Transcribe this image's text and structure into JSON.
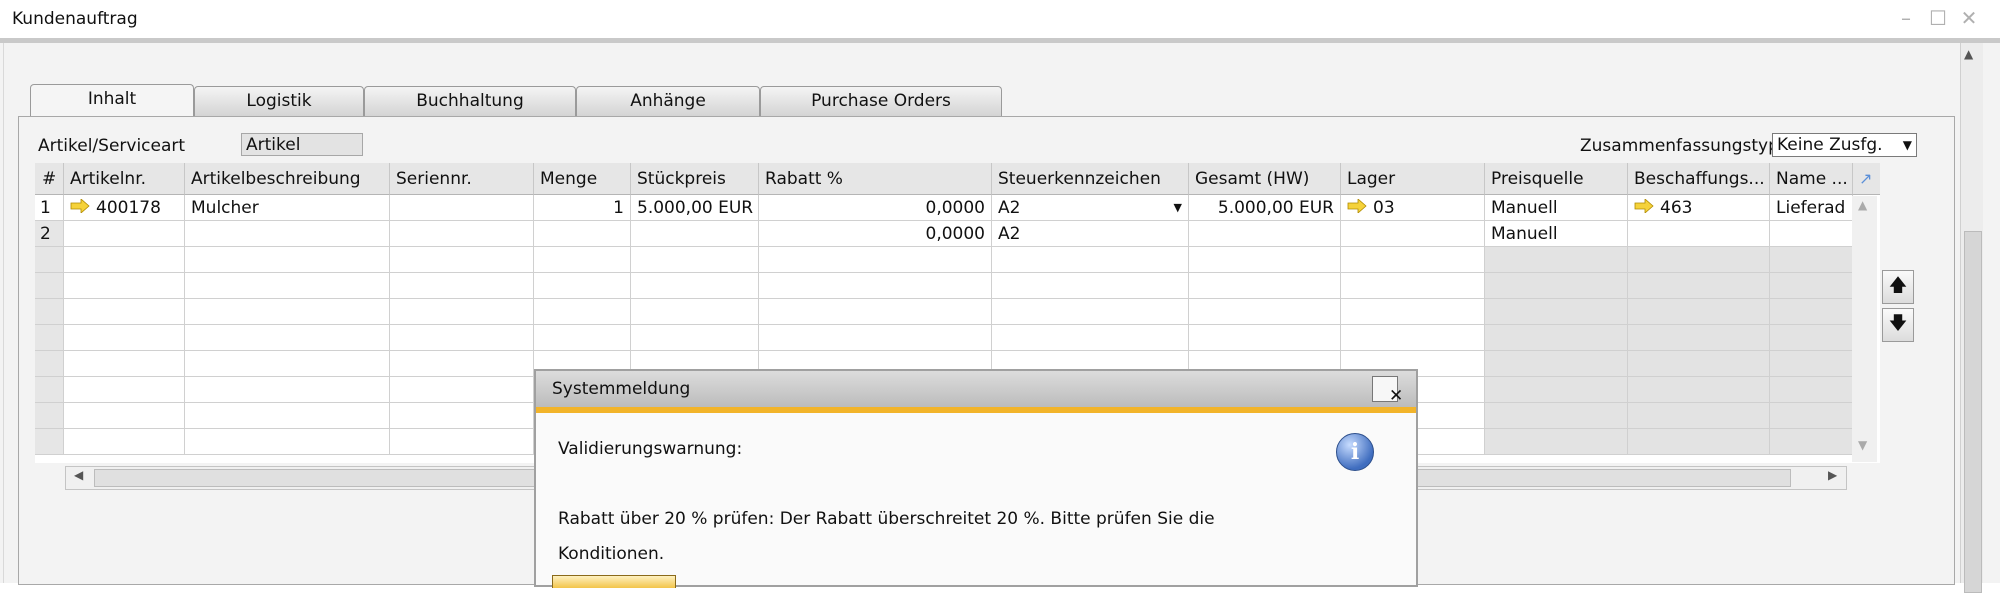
{
  "window": {
    "title": "Kundenauftrag"
  },
  "tabs": [
    {
      "label": "Inhalt"
    },
    {
      "label": "Logistik"
    },
    {
      "label": "Buchhaltung"
    },
    {
      "label": "Anhänge"
    },
    {
      "label": "Purchase Orders"
    }
  ],
  "form": {
    "item_type_label": "Artikel/Serviceart",
    "item_type_value": "Artikel",
    "summary_type_label": "Zusammenfassungstyp",
    "summary_type_value": "Keine Zusfg."
  },
  "grid": {
    "columns": [
      "#",
      "Artikelnr.",
      "Artikelbeschreibung",
      "Seriennr.",
      "Menge",
      "Stückpreis",
      "Rabatt %",
      "Steuerkennzeichen",
      "Gesamt (HW)",
      "Lager",
      "Preisquelle",
      "Beschaffungs...",
      "Name ..."
    ],
    "rows": [
      {
        "num": "1",
        "item_no": "400178",
        "desc": "Mulcher",
        "serial": "",
        "qty": "1",
        "unit_price": "5.000,00 EUR",
        "discount": "0,0000",
        "tax": "A2",
        "total": "5.000,00 EUR",
        "warehouse": "03",
        "price_source": "Manuell",
        "procurement": "463",
        "name": "Lieferad"
      },
      {
        "num": "2",
        "item_no": "",
        "desc": "",
        "serial": "",
        "qty": "",
        "unit_price": "",
        "discount": "0,0000",
        "tax": "A2",
        "total": "",
        "warehouse": "",
        "price_source": "Manuell",
        "procurement": "",
        "name": ""
      }
    ]
  },
  "dialog": {
    "title": "Systemmeldung",
    "heading": "Validierungswarnung:",
    "message_line1": "Rabatt über 20 % prüfen: Der Rabatt überschreitet 20 %. Bitte prüfen Sie die",
    "message_line2": "Konditionen."
  },
  "colors": {
    "accent": "#f2b42a",
    "arrow": "#f5d23a"
  }
}
